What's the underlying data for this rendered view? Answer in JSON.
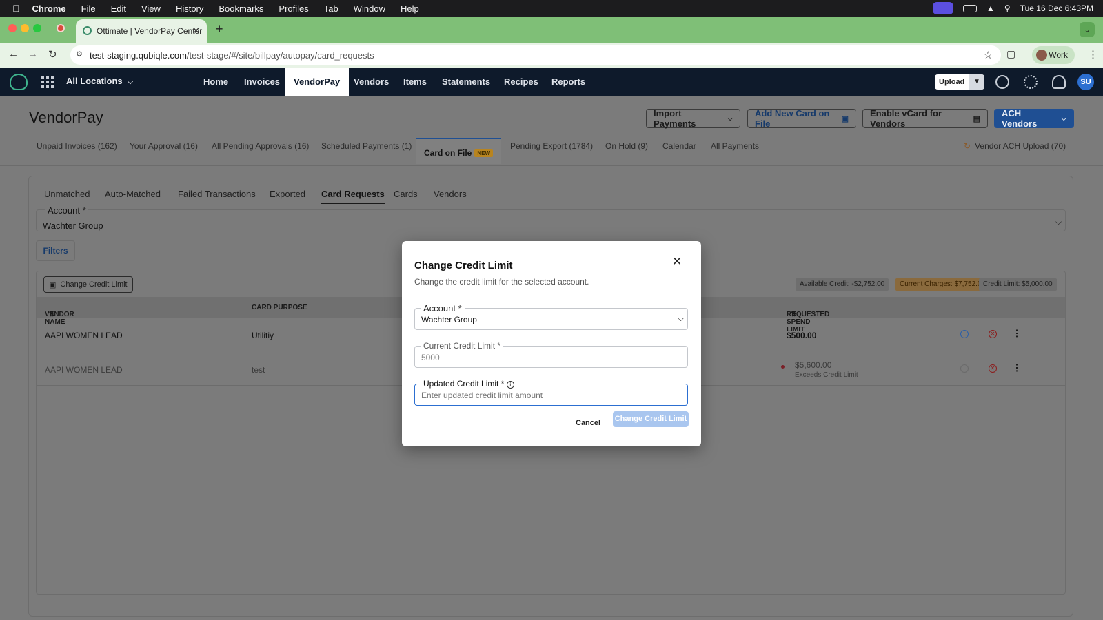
{
  "menubar": {
    "app": "Chrome",
    "items": [
      "File",
      "Edit",
      "View",
      "History",
      "Bookmarks",
      "Profiles",
      "Tab",
      "Window",
      "Help"
    ],
    "clock": "Tue 16 Dec  6:43PM"
  },
  "browser": {
    "tab_title": "Ottimate | VendorPay Center",
    "url_host": "test-staging.qubiqle.com",
    "url_path": "/test-stage/#/site/billpay/autopay/card_requests",
    "profile": "Work"
  },
  "appnav": {
    "location": "All Locations",
    "items": [
      "Home",
      "Invoices",
      "VendorPay",
      "Vendors",
      "Items",
      "Statements",
      "Recipes",
      "Reports"
    ],
    "active": "VendorPay",
    "upload": "Upload",
    "avatar": "SU"
  },
  "page": {
    "title": "VendorPay",
    "buttons": {
      "import": "Import Payments",
      "add_card": "Add New Card on File",
      "vcard": "Enable vCard for Vendors",
      "ach": "ACH Vendors"
    },
    "tabs": [
      "Unpaid Invoices (162)",
      "Your Approval (16)",
      "All Pending Approvals (16)",
      "Scheduled Payments (1)",
      "Card on File",
      "Pending Export (1784)",
      "On Hold (9)",
      "Calendar",
      "All Payments"
    ],
    "new_badge": "NEW",
    "vendor_ach_upload": "Vendor ACH Upload (70)",
    "subtabs": [
      "Unmatched",
      "Auto-Matched",
      "Failed Transactions",
      "Exported",
      "Card Requests",
      "Cards",
      "Vendors"
    ],
    "account_label": "Account *",
    "account_value": "Wachter Group",
    "filters": "Filters",
    "change_credit_limit": "Change Credit Limit",
    "pills": {
      "available": "Available Credit: -$2,752.00",
      "charges": "Current Charges: $7,752.00",
      "limit": "Credit Limit: $5,000.00"
    },
    "columns": {
      "vendor": "VENDOR NAME",
      "purpose": "CARD PURPOSE",
      "requested": "REQUESTED SPEND LIMIT"
    },
    "rows": [
      {
        "vendor": "AAPI WOMEN LEAD",
        "purpose": "Utilitiy",
        "amount": "$500.00",
        "note": ""
      },
      {
        "vendor": "AAPI WOMEN LEAD",
        "purpose": "test",
        "amount": "$5,600.00",
        "note": "Exceeds Credit Limit"
      }
    ]
  },
  "modal": {
    "title": "Change Credit Limit",
    "subtitle": "Change the credit limit for the selected account.",
    "account_label": "Account *",
    "account_value": "Wachter Group",
    "current_label": "Current Credit Limit *",
    "current_value": "5000",
    "updated_label": "Updated Credit Limit *",
    "updated_placeholder": "Enter updated credit limit amount",
    "cancel": "Cancel",
    "submit": "Change Credit Limit"
  },
  "colors": {
    "brand": "#1f4f93",
    "nav": "#0e1a2b",
    "chrome": "#7fbf77",
    "error": "#d0304a"
  }
}
